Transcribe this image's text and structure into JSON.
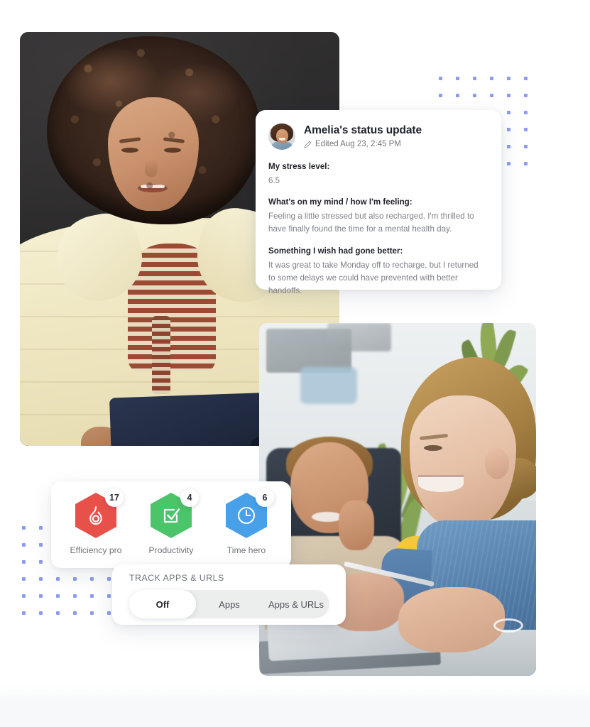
{
  "status_card": {
    "avatar_icon": "user-avatar",
    "title": "Amelia's status update",
    "edit_icon": "pencil-icon",
    "edited_meta": "Edited Aug 23, 2:45 PM",
    "fields": [
      {
        "label": "My stress level:",
        "value": "6.5"
      },
      {
        "label": "What's on my mind / how I'm feeling:",
        "value": "Feeling a little stressed but also recharged. I'm thrilled to have finally found the time for a mental health day."
      },
      {
        "label": "Something I wish had gone better:",
        "value": "It was great to take Monday off to recharge, but I returned to some delays we could have prevented with better handoffs."
      }
    ]
  },
  "badges_card": {
    "items": [
      {
        "icon": "flame-icon",
        "count": "17",
        "label": "Efficiency pro",
        "color": "#e8504a"
      },
      {
        "icon": "checkbox-icon",
        "count": "4",
        "label": "Productivity",
        "color": "#4cc46a"
      },
      {
        "icon": "clock-icon",
        "count": "6",
        "label": "Time hero",
        "color": "#47a0e8"
      }
    ]
  },
  "track_card": {
    "title": "TRACK APPS & URLS",
    "options": [
      {
        "label": "Off",
        "selected": true
      },
      {
        "label": "Apps",
        "selected": false
      },
      {
        "label": "Apps & URLs",
        "selected": false
      }
    ]
  },
  "photos": [
    {
      "name": "woman-with-laptop-photo",
      "alt": "Woman with curly hair in a cream puffer jacket holding a navy laptop"
    },
    {
      "name": "office-colleagues-photo",
      "alt": "Smiling woman in denim jacket and laughing colleague in an office"
    }
  ],
  "decor": {
    "dot_color": "#8c9bf0",
    "grids": [
      {
        "name": "dot-grid-top-right",
        "cols": 6,
        "rows": 6
      },
      {
        "name": "dot-grid-bottom-left",
        "cols": 6,
        "rows": 6
      }
    ]
  }
}
